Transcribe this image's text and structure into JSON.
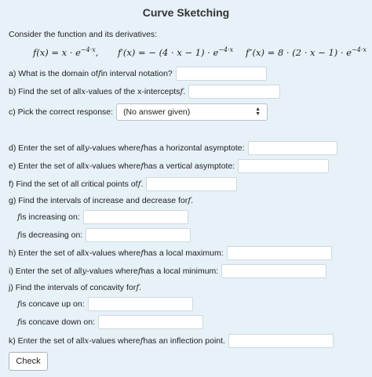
{
  "title": "Curve Sketching",
  "intro": "Consider the function and its derivatives:",
  "formulas": {
    "f": "f(x) = x · e",
    "f_exp": "−4·x",
    "f_tail": ",",
    "fp": "f′(x) = − (4 · x − 1) · e",
    "fp_exp": "−4·x",
    "fpp": "f″(x) = 8 · (2 · x − 1) · e",
    "fpp_exp": "−4·x"
  },
  "f_symbol": "f",
  "x_symbol": "x",
  "y_symbol": "y",
  "questions": {
    "a_pre": "a)  What is the domain of ",
    "a_post": " in interval notation?",
    "b_pre": "b)  Find the set of all ",
    "b_post": "-values of the x-intercepts ",
    "b_end": ".",
    "c": "c)  Pick the correct response:",
    "c_select": "(No answer given)",
    "d_pre": "d)  Enter the set of all ",
    "d_mid": "-values where ",
    "d_post": " has a horizontal asymptote:",
    "e_pre": "e)  Enter the set of all ",
    "e_mid": "-values where ",
    "e_post": " has a vertical asymptote:",
    "f_pre": "f)  Find the set of all critical points of ",
    "f_end": ".",
    "g_pre": "g)  Find the intervals of increase and decrease for ",
    "g_end": ".",
    "g_inc": " is increasing on:",
    "g_dec": " is decreasing on:",
    "h_pre": "h)  Enter the set of all ",
    "h_mid": "-values where ",
    "h_post": " has a local maximum:",
    "i_pre": "i)  Enter the set of all ",
    "i_mid": "-values where ",
    "i_post": " has a local minimum:",
    "j_pre": "j)  Find the intervals of concavity for ",
    "j_end": ".",
    "j_up": " is concave up on:",
    "j_down": " is concave down on:",
    "k_pre": "k)  Enter the set of all ",
    "k_mid": "-values where ",
    "k_post": " has an inflection point."
  },
  "check_label": "Check"
}
